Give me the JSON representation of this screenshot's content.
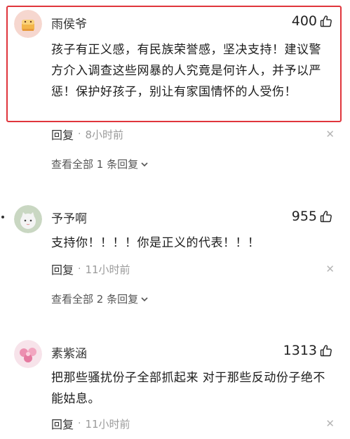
{
  "comments": [
    {
      "username": "雨侯爷",
      "likes": "400",
      "text": "孩子有正义感，有民族荣誉感，坚决支持！建议警方介入调查这些网暴的人究竟是何许人，并予以严惩！保护好孩子，别让有家国情怀的人受伤！",
      "reply_label": "回复",
      "separator": "·",
      "time": "8小时前",
      "view_all": "查看全部 1 条回复",
      "highlighted": true
    },
    {
      "username": "予予啊",
      "likes": "955",
      "text": "支持你！！！！你是正义的代表！！！",
      "reply_label": "回复",
      "separator": "·",
      "time": "11小时前",
      "view_all": "查看全部 2 条回复"
    },
    {
      "username": "素紫涵",
      "likes": "1313",
      "text": "把那些骚扰份子全部抓起来 对于那些反动份子绝不能姑息。",
      "reply_label": "回复",
      "separator": "·",
      "time": "11小时前"
    }
  ],
  "icons": {
    "like": "thumbs-up-icon",
    "close": "close-icon",
    "expand": "chevron-down-icon"
  },
  "colors": {
    "highlight_border": "#e0353c",
    "secondary_text": "#9a9a9a"
  }
}
